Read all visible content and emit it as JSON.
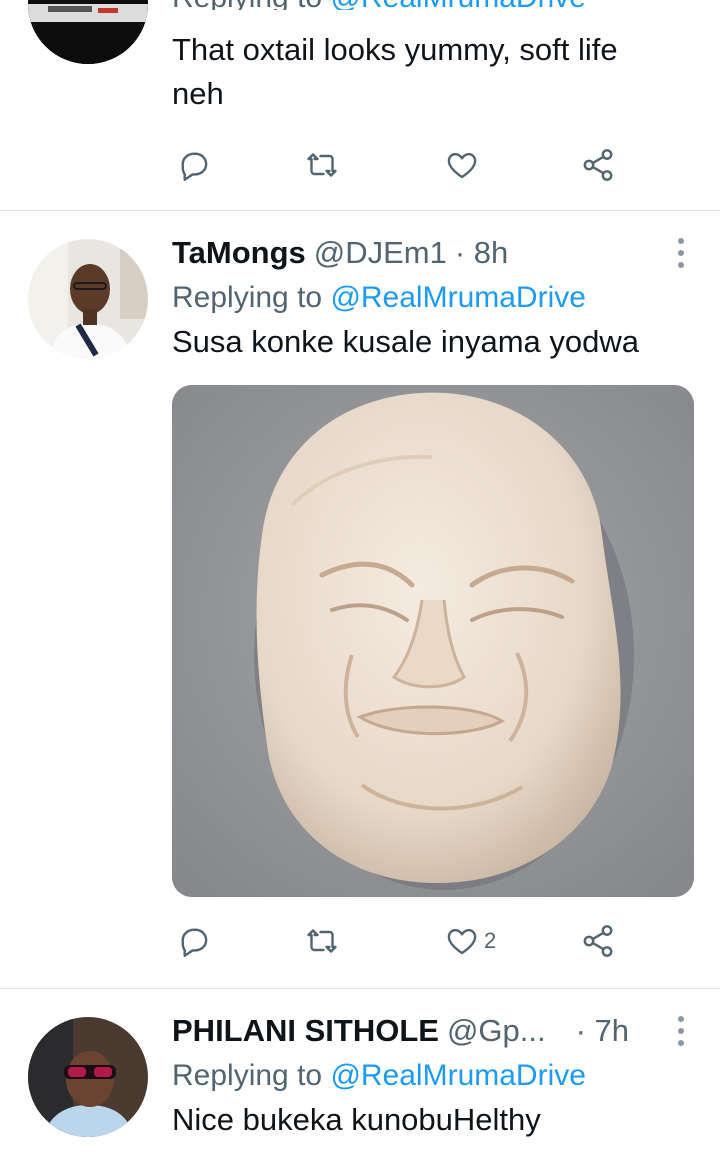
{
  "tweets": [
    {
      "reply_prefix": "Replying to",
      "reply_to": "@RealMrumaDrive",
      "text": "That oxtail looks yummy, soft life neh",
      "likes": ""
    },
    {
      "name": "TaMongs",
      "handle": "@DJEm1",
      "time": "· 8h",
      "reply_prefix": "Replying to",
      "reply_to": "@RealMrumaDrive",
      "text": "Susa konke kusale inyama yodwa",
      "likes": "2"
    },
    {
      "name": "PHILANI SITHOLE",
      "handle": "@Gp...",
      "time": "· 7h",
      "reply_prefix": "Replying to",
      "reply_to": "@RealMrumaDrive",
      "text": "Nice bukeka kunobuHelthy"
    }
  ],
  "icons": {
    "reply": "speech-bubble-icon",
    "retweet": "retweet-icon",
    "like": "heart-icon",
    "share": "share-icon",
    "more": "more-vertical-icon"
  },
  "colors": {
    "link": "#1d9bf0",
    "secondary": "#536471",
    "text": "#0f1419",
    "divider": "#dfe3e6"
  }
}
